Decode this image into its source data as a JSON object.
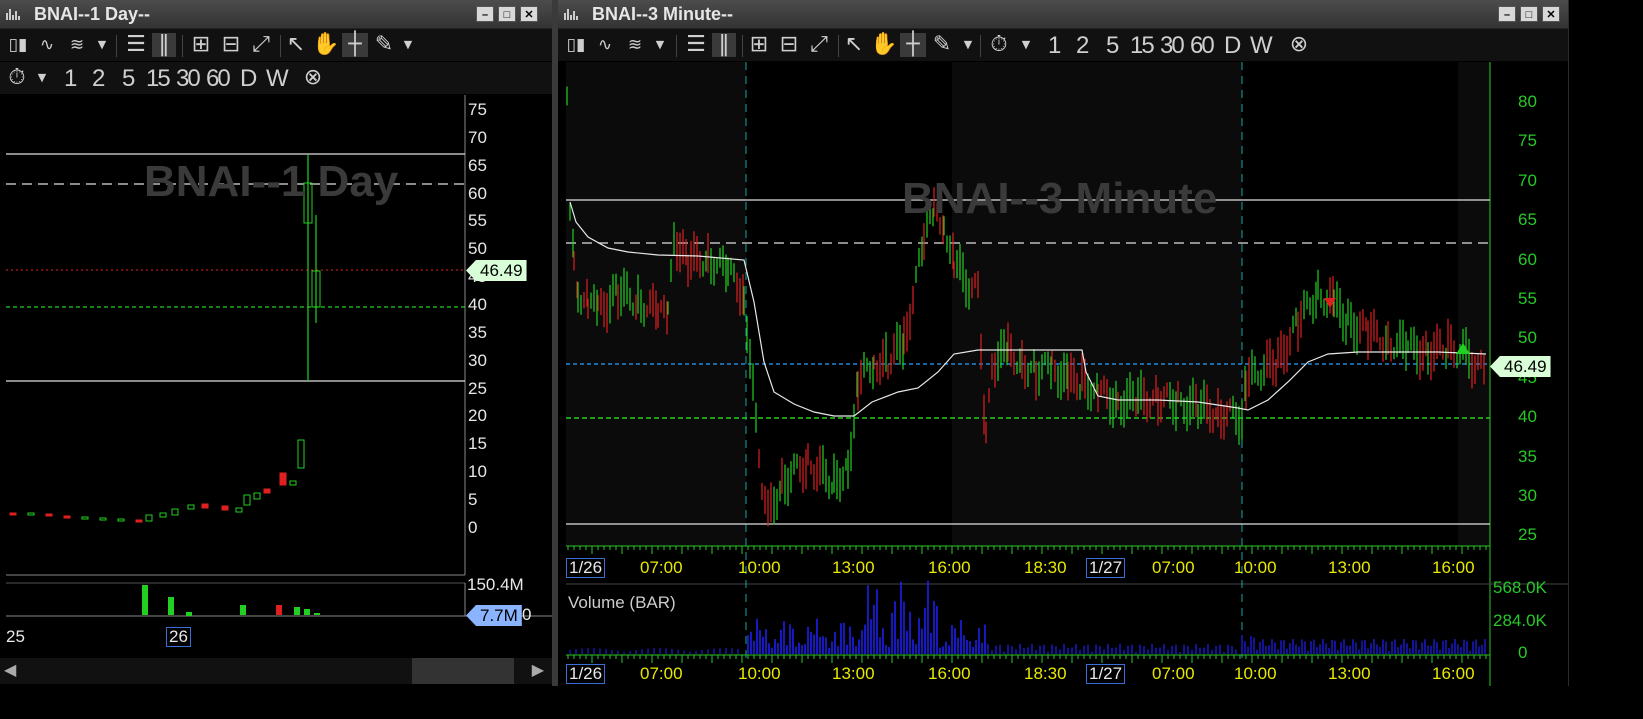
{
  "left": {
    "title": "BNAI--1 Day--",
    "watermark": "BNAI--1 Day",
    "price_tag": "46.49",
    "volume_max": "150.4M",
    "volume_tag": "7.7M",
    "volume_tag_suffix": "0",
    "y_ticks": [
      "75",
      "70",
      "65",
      "60",
      "55",
      "50",
      "45",
      "40",
      "35",
      "30",
      "25",
      "20",
      "15",
      "10",
      "5",
      "0"
    ],
    "x_ticks": [
      "25",
      "26"
    ],
    "timeframes": [
      "1",
      "2",
      "5",
      "15",
      "30",
      "60",
      "D",
      "W"
    ]
  },
  "right": {
    "title": "BNAI--3 Minute--",
    "watermark": "BNAI--3 Minute",
    "price_tag": "46.49",
    "y_ticks": [
      "80",
      "75",
      "70",
      "65",
      "60",
      "55",
      "50",
      "45",
      "40",
      "35",
      "30",
      "25"
    ],
    "volume_title": "Volume (BAR)",
    "volume_ticks": [
      "568.0K",
      "284.0K",
      "0"
    ],
    "x_ticks": [
      "1/26",
      "07:00",
      "10:00",
      "13:00",
      "16:00",
      "18:30",
      "1/27",
      "07:00",
      "10:00",
      "13:00",
      "16:00"
    ],
    "timeframes": [
      "1",
      "2",
      "5",
      "15",
      "30",
      "60",
      "D",
      "W"
    ]
  },
  "colors": {
    "up": "#22d022",
    "down": "#e02020",
    "axis_green": "#28c828",
    "volume_blue": "#2020ff",
    "price_line_blue": "#2aa0ff"
  },
  "icons": [
    "bar-chart-icon",
    "line-chart-icon",
    "zoom-in-icon",
    "zoom-out-icon",
    "fit-icon",
    "pointer-icon",
    "hand-icon",
    "crosshair-icon",
    "pencil-icon",
    "timer-icon",
    "close-circle-icon"
  ]
}
